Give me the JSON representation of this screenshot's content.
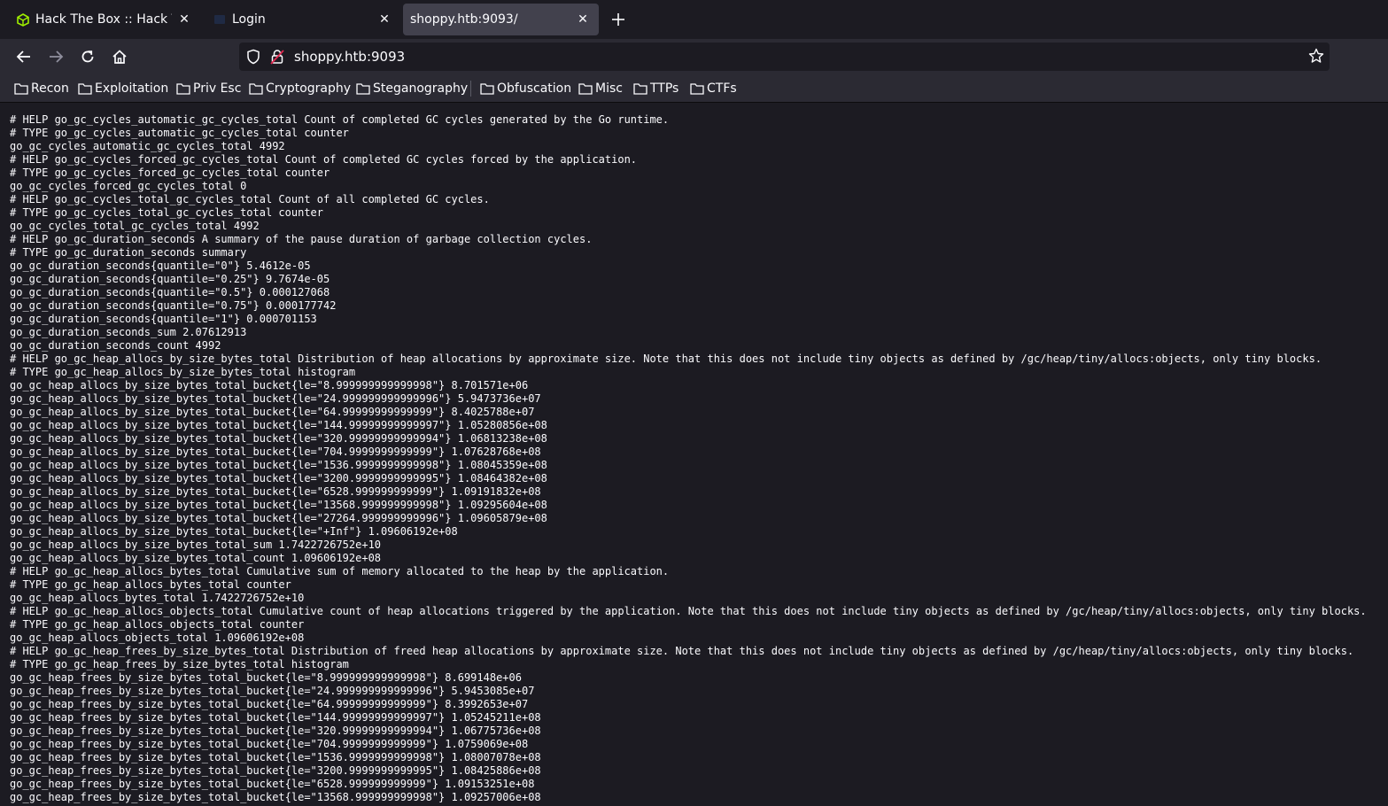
{
  "tabs": [
    {
      "title": "Hack The Box :: Hack The Box",
      "icon": "htb-cube-icon"
    },
    {
      "title": "Login",
      "icon": "page-icon"
    },
    {
      "title": "shoppy.htb:9093/",
      "icon": "none",
      "active": true
    }
  ],
  "address_bar": {
    "url": "shoppy.htb:9093"
  },
  "bookmarks": [
    "Recon",
    "Exploitation",
    "Priv Esc",
    "Cryptography",
    "Steganography",
    "Obfuscation",
    "Misc",
    "TTPs",
    "CTFs"
  ],
  "page": {
    "lines": [
      "# HELP go_gc_cycles_automatic_gc_cycles_total Count of completed GC cycles generated by the Go runtime.",
      "# TYPE go_gc_cycles_automatic_gc_cycles_total counter",
      "go_gc_cycles_automatic_gc_cycles_total 4992",
      "# HELP go_gc_cycles_forced_gc_cycles_total Count of completed GC cycles forced by the application.",
      "# TYPE go_gc_cycles_forced_gc_cycles_total counter",
      "go_gc_cycles_forced_gc_cycles_total 0",
      "# HELP go_gc_cycles_total_gc_cycles_total Count of all completed GC cycles.",
      "# TYPE go_gc_cycles_total_gc_cycles_total counter",
      "go_gc_cycles_total_gc_cycles_total 4992",
      "# HELP go_gc_duration_seconds A summary of the pause duration of garbage collection cycles.",
      "# TYPE go_gc_duration_seconds summary",
      "go_gc_duration_seconds{quantile=\"0\"} 5.4612e-05",
      "go_gc_duration_seconds{quantile=\"0.25\"} 9.7674e-05",
      "go_gc_duration_seconds{quantile=\"0.5\"} 0.000127068",
      "go_gc_duration_seconds{quantile=\"0.75\"} 0.000177742",
      "go_gc_duration_seconds{quantile=\"1\"} 0.000701153",
      "go_gc_duration_seconds_sum 2.07612913",
      "go_gc_duration_seconds_count 4992",
      "# HELP go_gc_heap_allocs_by_size_bytes_total Distribution of heap allocations by approximate size. Note that this does not include tiny objects as defined by /gc/heap/tiny/allocs:objects, only tiny blocks.",
      "# TYPE go_gc_heap_allocs_by_size_bytes_total histogram",
      "go_gc_heap_allocs_by_size_bytes_total_bucket{le=\"8.999999999999998\"} 8.701571e+06",
      "go_gc_heap_allocs_by_size_bytes_total_bucket{le=\"24.999999999999996\"} 5.9473736e+07",
      "go_gc_heap_allocs_by_size_bytes_total_bucket{le=\"64.99999999999999\"} 8.4025788e+07",
      "go_gc_heap_allocs_by_size_bytes_total_bucket{le=\"144.99999999999997\"} 1.05280856e+08",
      "go_gc_heap_allocs_by_size_bytes_total_bucket{le=\"320.99999999999994\"} 1.06813238e+08",
      "go_gc_heap_allocs_by_size_bytes_total_bucket{le=\"704.9999999999999\"} 1.07628768e+08",
      "go_gc_heap_allocs_by_size_bytes_total_bucket{le=\"1536.9999999999998\"} 1.08045359e+08",
      "go_gc_heap_allocs_by_size_bytes_total_bucket{le=\"3200.9999999999995\"} 1.08464382e+08",
      "go_gc_heap_allocs_by_size_bytes_total_bucket{le=\"6528.999999999999\"} 1.09191832e+08",
      "go_gc_heap_allocs_by_size_bytes_total_bucket{le=\"13568.999999999998\"} 1.09295604e+08",
      "go_gc_heap_allocs_by_size_bytes_total_bucket{le=\"27264.999999999996\"} 1.09605879e+08",
      "go_gc_heap_allocs_by_size_bytes_total_bucket{le=\"+Inf\"} 1.09606192e+08",
      "go_gc_heap_allocs_by_size_bytes_total_sum 1.7422726752e+10",
      "go_gc_heap_allocs_by_size_bytes_total_count 1.09606192e+08",
      "# HELP go_gc_heap_allocs_bytes_total Cumulative sum of memory allocated to the heap by the application.",
      "# TYPE go_gc_heap_allocs_bytes_total counter",
      "go_gc_heap_allocs_bytes_total 1.7422726752e+10",
      "# HELP go_gc_heap_allocs_objects_total Cumulative count of heap allocations triggered by the application. Note that this does not include tiny objects as defined by /gc/heap/tiny/allocs:objects, only tiny blocks.",
      "# TYPE go_gc_heap_allocs_objects_total counter",
      "go_gc_heap_allocs_objects_total 1.09606192e+08",
      "# HELP go_gc_heap_frees_by_size_bytes_total Distribution of freed heap allocations by approximate size. Note that this does not include tiny objects as defined by /gc/heap/tiny/allocs:objects, only tiny blocks.",
      "# TYPE go_gc_heap_frees_by_size_bytes_total histogram",
      "go_gc_heap_frees_by_size_bytes_total_bucket{le=\"8.999999999999998\"} 8.699148e+06",
      "go_gc_heap_frees_by_size_bytes_total_bucket{le=\"24.999999999999996\"} 5.9453085e+07",
      "go_gc_heap_frees_by_size_bytes_total_bucket{le=\"64.99999999999999\"} 8.3992653e+07",
      "go_gc_heap_frees_by_size_bytes_total_bucket{le=\"144.99999999999997\"} 1.05245211e+08",
      "go_gc_heap_frees_by_size_bytes_total_bucket{le=\"320.99999999999994\"} 1.06775736e+08",
      "go_gc_heap_frees_by_size_bytes_total_bucket{le=\"704.9999999999999\"} 1.0759069e+08",
      "go_gc_heap_frees_by_size_bytes_total_bucket{le=\"1536.9999999999998\"} 1.08007078e+08",
      "go_gc_heap_frees_by_size_bytes_total_bucket{le=\"3200.9999999999995\"} 1.08425886e+08",
      "go_gc_heap_frees_by_size_bytes_total_bucket{le=\"6528.999999999999\"} 1.09153251e+08",
      "go_gc_heap_frees_by_size_bytes_total_bucket{le=\"13568.999999999998\"} 1.09257006e+08"
    ]
  }
}
